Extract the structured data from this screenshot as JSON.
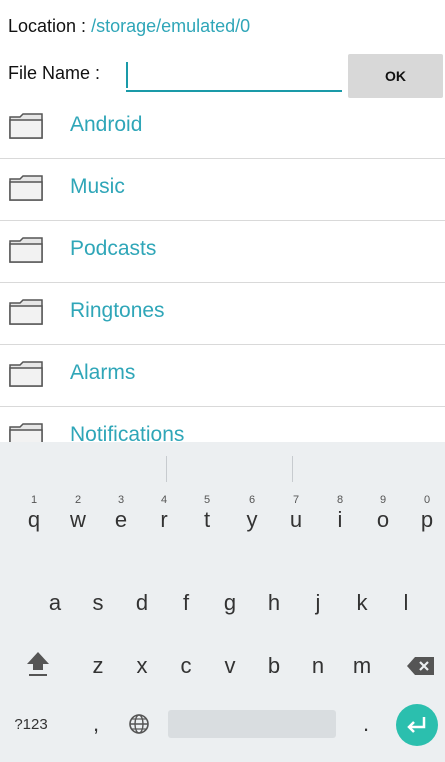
{
  "header": {
    "location_label": "Location : ",
    "location_path": "/storage/emulated/0",
    "filename_label": "File Name :",
    "filename_value": "",
    "ok_label": "OK"
  },
  "folders": [
    {
      "name": "Android"
    },
    {
      "name": "Music"
    },
    {
      "name": "Podcasts"
    },
    {
      "name": "Ringtones"
    },
    {
      "name": "Alarms"
    },
    {
      "name": "Notifications"
    }
  ],
  "keyboard": {
    "row1": [
      {
        "key": "q",
        "hint": "1"
      },
      {
        "key": "w",
        "hint": "2"
      },
      {
        "key": "e",
        "hint": "3"
      },
      {
        "key": "r",
        "hint": "4"
      },
      {
        "key": "t",
        "hint": "5"
      },
      {
        "key": "y",
        "hint": "6"
      },
      {
        "key": "u",
        "hint": "7"
      },
      {
        "key": "i",
        "hint": "8"
      },
      {
        "key": "o",
        "hint": "9"
      },
      {
        "key": "p",
        "hint": "0"
      }
    ],
    "row2": [
      "a",
      "s",
      "d",
      "f",
      "g",
      "h",
      "j",
      "k",
      "l"
    ],
    "row3": [
      "z",
      "x",
      "c",
      "v",
      "b",
      "n",
      "m"
    ],
    "symbols_label": "?123",
    "comma": ",",
    "period": "."
  },
  "colors": {
    "accent": "#2fa6b8",
    "enter": "#2bbfae"
  }
}
